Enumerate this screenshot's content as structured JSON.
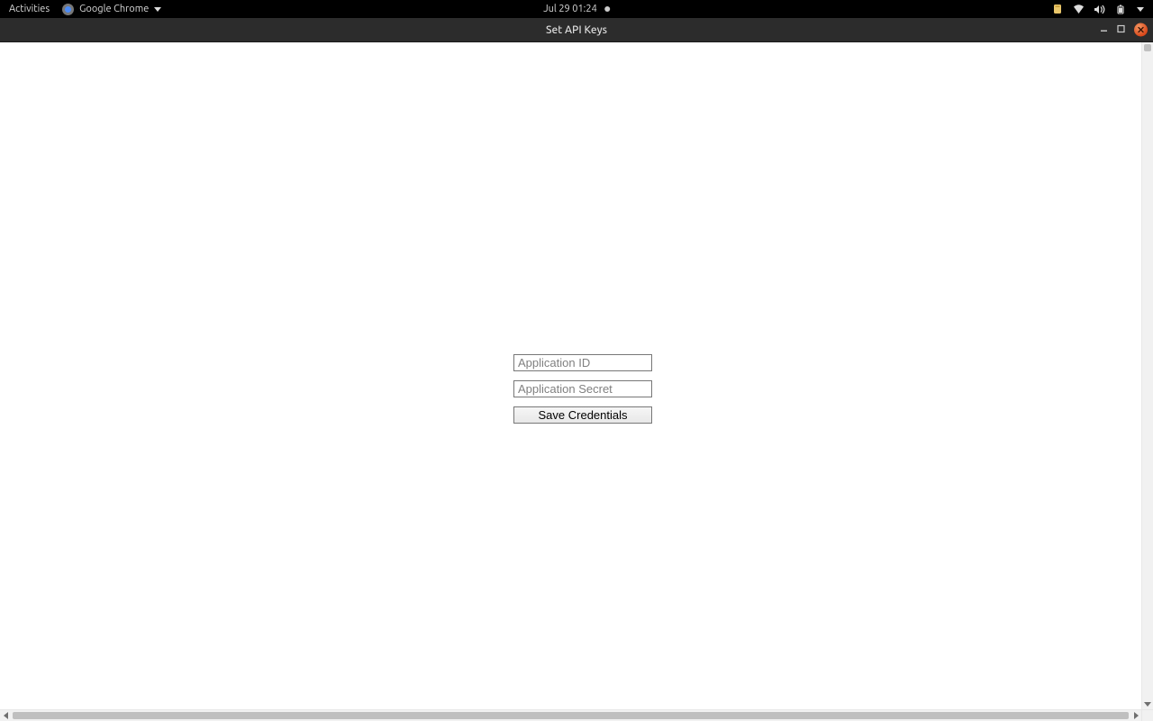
{
  "top_panel": {
    "activities": "Activities",
    "app_name": "Google Chrome",
    "datetime": "Jul 29  01:24"
  },
  "window": {
    "title": "Set API Keys"
  },
  "form": {
    "app_id": {
      "placeholder": "Application ID",
      "value": ""
    },
    "app_secret": {
      "placeholder": "Application Secret",
      "value": ""
    },
    "save_label": "Save Credentials"
  }
}
